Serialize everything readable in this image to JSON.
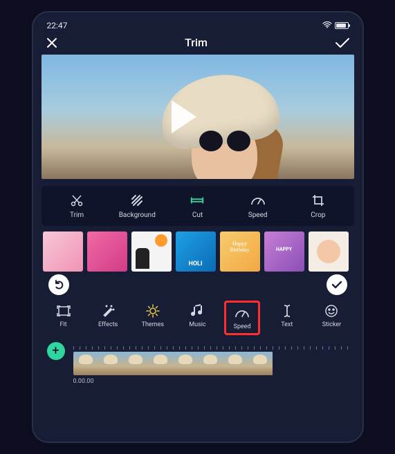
{
  "status": {
    "time": "22:47"
  },
  "header": {
    "title": "Trim"
  },
  "toolbar": {
    "items": [
      {
        "id": "trim",
        "label": "Trim"
      },
      {
        "id": "background",
        "label": "Background"
      },
      {
        "id": "cut",
        "label": "Cut"
      },
      {
        "id": "speed",
        "label": "Speed"
      },
      {
        "id": "crop",
        "label": "Crop"
      }
    ]
  },
  "ops": {
    "items": [
      {
        "id": "fit",
        "label": "Fit"
      },
      {
        "id": "effects",
        "label": "Effects"
      },
      {
        "id": "themes",
        "label": "Themes"
      },
      {
        "id": "music",
        "label": "Music"
      },
      {
        "id": "speed",
        "label": "Speed"
      },
      {
        "id": "text",
        "label": "Text"
      },
      {
        "id": "sticker",
        "label": "Sticker"
      }
    ]
  },
  "timeline": {
    "timecode": "0.00.00"
  }
}
